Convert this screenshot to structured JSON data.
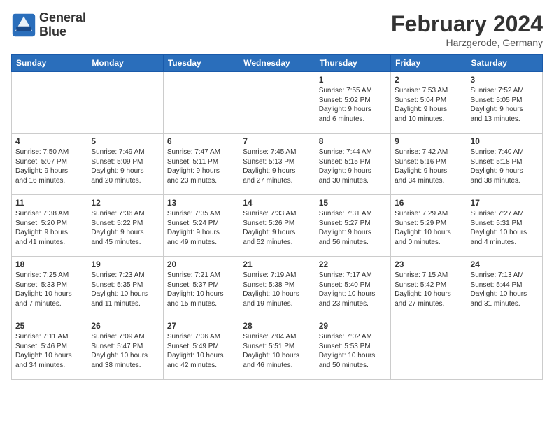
{
  "header": {
    "logo_text_line1": "General",
    "logo_text_line2": "Blue",
    "month_year": "February 2024",
    "location": "Harzgerode, Germany"
  },
  "days_of_week": [
    "Sunday",
    "Monday",
    "Tuesday",
    "Wednesday",
    "Thursday",
    "Friday",
    "Saturday"
  ],
  "weeks": [
    [
      {
        "day": "",
        "info": ""
      },
      {
        "day": "",
        "info": ""
      },
      {
        "day": "",
        "info": ""
      },
      {
        "day": "",
        "info": ""
      },
      {
        "day": "1",
        "info": "Sunrise: 7:55 AM\nSunset: 5:02 PM\nDaylight: 9 hours\nand 6 minutes."
      },
      {
        "day": "2",
        "info": "Sunrise: 7:53 AM\nSunset: 5:04 PM\nDaylight: 9 hours\nand 10 minutes."
      },
      {
        "day": "3",
        "info": "Sunrise: 7:52 AM\nSunset: 5:05 PM\nDaylight: 9 hours\nand 13 minutes."
      }
    ],
    [
      {
        "day": "4",
        "info": "Sunrise: 7:50 AM\nSunset: 5:07 PM\nDaylight: 9 hours\nand 16 minutes."
      },
      {
        "day": "5",
        "info": "Sunrise: 7:49 AM\nSunset: 5:09 PM\nDaylight: 9 hours\nand 20 minutes."
      },
      {
        "day": "6",
        "info": "Sunrise: 7:47 AM\nSunset: 5:11 PM\nDaylight: 9 hours\nand 23 minutes."
      },
      {
        "day": "7",
        "info": "Sunrise: 7:45 AM\nSunset: 5:13 PM\nDaylight: 9 hours\nand 27 minutes."
      },
      {
        "day": "8",
        "info": "Sunrise: 7:44 AM\nSunset: 5:15 PM\nDaylight: 9 hours\nand 30 minutes."
      },
      {
        "day": "9",
        "info": "Sunrise: 7:42 AM\nSunset: 5:16 PM\nDaylight: 9 hours\nand 34 minutes."
      },
      {
        "day": "10",
        "info": "Sunrise: 7:40 AM\nSunset: 5:18 PM\nDaylight: 9 hours\nand 38 minutes."
      }
    ],
    [
      {
        "day": "11",
        "info": "Sunrise: 7:38 AM\nSunset: 5:20 PM\nDaylight: 9 hours\nand 41 minutes."
      },
      {
        "day": "12",
        "info": "Sunrise: 7:36 AM\nSunset: 5:22 PM\nDaylight: 9 hours\nand 45 minutes."
      },
      {
        "day": "13",
        "info": "Sunrise: 7:35 AM\nSunset: 5:24 PM\nDaylight: 9 hours\nand 49 minutes."
      },
      {
        "day": "14",
        "info": "Sunrise: 7:33 AM\nSunset: 5:26 PM\nDaylight: 9 hours\nand 52 minutes."
      },
      {
        "day": "15",
        "info": "Sunrise: 7:31 AM\nSunset: 5:27 PM\nDaylight: 9 hours\nand 56 minutes."
      },
      {
        "day": "16",
        "info": "Sunrise: 7:29 AM\nSunset: 5:29 PM\nDaylight: 10 hours\nand 0 minutes."
      },
      {
        "day": "17",
        "info": "Sunrise: 7:27 AM\nSunset: 5:31 PM\nDaylight: 10 hours\nand 4 minutes."
      }
    ],
    [
      {
        "day": "18",
        "info": "Sunrise: 7:25 AM\nSunset: 5:33 PM\nDaylight: 10 hours\nand 7 minutes."
      },
      {
        "day": "19",
        "info": "Sunrise: 7:23 AM\nSunset: 5:35 PM\nDaylight: 10 hours\nand 11 minutes."
      },
      {
        "day": "20",
        "info": "Sunrise: 7:21 AM\nSunset: 5:37 PM\nDaylight: 10 hours\nand 15 minutes."
      },
      {
        "day": "21",
        "info": "Sunrise: 7:19 AM\nSunset: 5:38 PM\nDaylight: 10 hours\nand 19 minutes."
      },
      {
        "day": "22",
        "info": "Sunrise: 7:17 AM\nSunset: 5:40 PM\nDaylight: 10 hours\nand 23 minutes."
      },
      {
        "day": "23",
        "info": "Sunrise: 7:15 AM\nSunset: 5:42 PM\nDaylight: 10 hours\nand 27 minutes."
      },
      {
        "day": "24",
        "info": "Sunrise: 7:13 AM\nSunset: 5:44 PM\nDaylight: 10 hours\nand 31 minutes."
      }
    ],
    [
      {
        "day": "25",
        "info": "Sunrise: 7:11 AM\nSunset: 5:46 PM\nDaylight: 10 hours\nand 34 minutes."
      },
      {
        "day": "26",
        "info": "Sunrise: 7:09 AM\nSunset: 5:47 PM\nDaylight: 10 hours\nand 38 minutes."
      },
      {
        "day": "27",
        "info": "Sunrise: 7:06 AM\nSunset: 5:49 PM\nDaylight: 10 hours\nand 42 minutes."
      },
      {
        "day": "28",
        "info": "Sunrise: 7:04 AM\nSunset: 5:51 PM\nDaylight: 10 hours\nand 46 minutes."
      },
      {
        "day": "29",
        "info": "Sunrise: 7:02 AM\nSunset: 5:53 PM\nDaylight: 10 hours\nand 50 minutes."
      },
      {
        "day": "",
        "info": ""
      },
      {
        "day": "",
        "info": ""
      }
    ]
  ]
}
